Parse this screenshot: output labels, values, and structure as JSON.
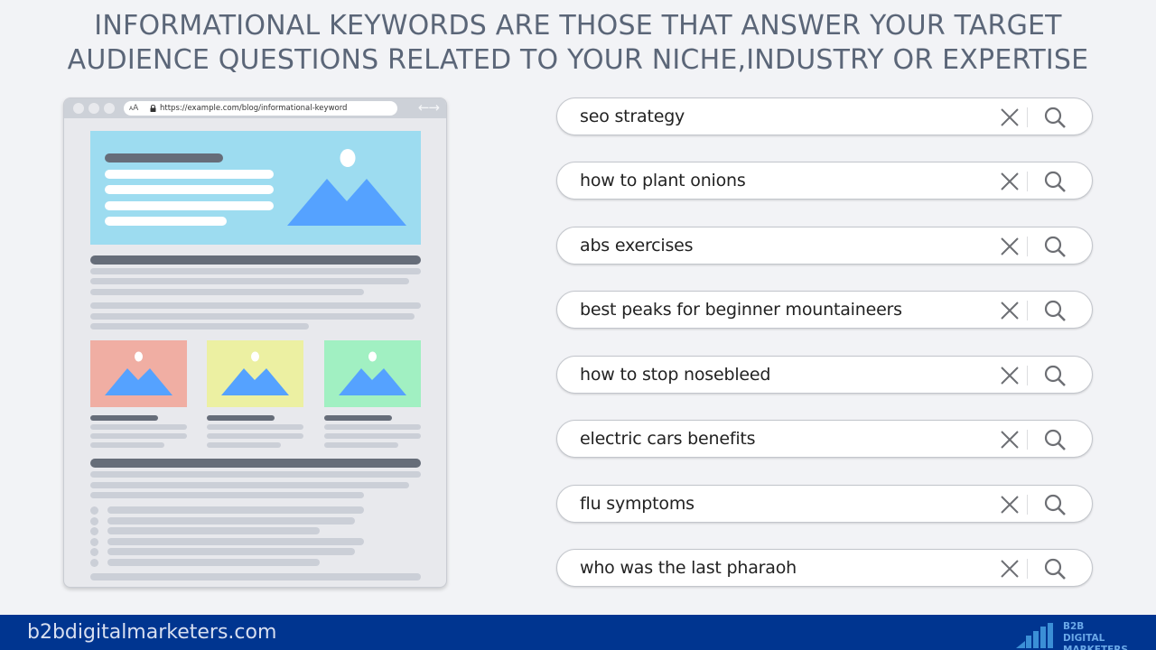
{
  "headline": {
    "line1": "INFORMATIONAL KEYWORDS ARE THOSE THAT ANSWER YOUR TARGET",
    "line2": "AUDIENCE QUESTIONS RELATED TO YOUR NICHE,INDUSTRY OR EXPERTISE"
  },
  "browser": {
    "text_size_label_small": "A",
    "text_size_label_large": "A",
    "url": "https://example.com/blog/informational-keyword",
    "nav_arrows": "←→",
    "icons": [
      "lock-icon",
      "back-arrow-icon",
      "forward-arrow-icon",
      "image-placeholder-icon"
    ],
    "card_colors": [
      "#f0aea3",
      "#ecf0a2",
      "#a1f0c2"
    ],
    "hero_color": "#9ddcf0",
    "mountain_color": "#55a2ff"
  },
  "searches": [
    {
      "query": "seo strategy"
    },
    {
      "query": "how to plant onions"
    },
    {
      "query": "abs exercises"
    },
    {
      "query": "best peaks for beginner mountaineers"
    },
    {
      "query": "how to stop nosebleed"
    },
    {
      "query": "electric cars benefits"
    },
    {
      "query": "flu symptoms"
    },
    {
      "query": "who was the last pharaoh"
    }
  ],
  "search_icons": {
    "clear": "close-icon",
    "search": "search-icon"
  },
  "footer": {
    "site": "b2bdigitalmarketers.com",
    "logo_line1": "B2B DIGITAL",
    "logo_line2": "MARKETERS",
    "bg_color": "#003590"
  }
}
